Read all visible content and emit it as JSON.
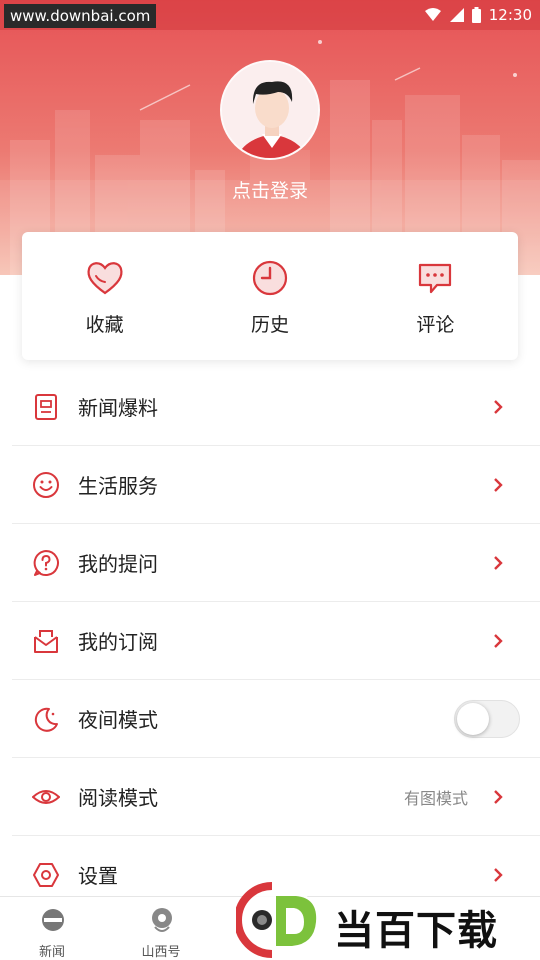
{
  "status_bar": {
    "watermark_url": "www.downbai.com",
    "time": "12:30"
  },
  "profile": {
    "login_prompt": "点击登录"
  },
  "quick_actions": [
    {
      "label": "收藏",
      "icon": "heart-icon"
    },
    {
      "label": "历史",
      "icon": "clock-icon"
    },
    {
      "label": "评论",
      "icon": "comment-icon"
    }
  ],
  "menu": [
    {
      "label": "新闻爆料",
      "icon": "document-icon"
    },
    {
      "label": "生活服务",
      "icon": "smiley-icon"
    },
    {
      "label": "我的提问",
      "icon": "question-icon"
    },
    {
      "label": "我的订阅",
      "icon": "inbox-icon"
    },
    {
      "label": "夜间模式",
      "icon": "moon-icon",
      "toggle_on": false
    },
    {
      "label": "阅读模式",
      "icon": "eye-icon",
      "value": "有图模式"
    },
    {
      "label": "设置",
      "icon": "hexagon-settings-icon"
    }
  ],
  "bottom_nav": [
    {
      "label": "新闻",
      "icon": "news-icon"
    },
    {
      "label": "山西号",
      "icon": "location-icon"
    }
  ],
  "brand_watermark": {
    "text": "当百下载",
    "letter": "D"
  },
  "colors": {
    "accent": "#d9373c",
    "header_top": "#e65255",
    "header_bottom": "#f7c2b3"
  }
}
